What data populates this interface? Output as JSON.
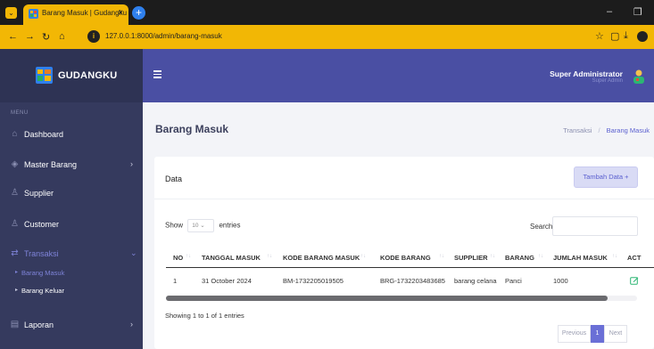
{
  "browser": {
    "tab_title": "Barang Masuk | Gudangku",
    "tab_close": "×",
    "new_tab": "+",
    "url": "127.0.0.1:8000/admin/barang-masuk",
    "minimize": "–",
    "restore": "❐"
  },
  "sidebar": {
    "brand": "GUDANGKU",
    "menu_heading": "MENU",
    "items": [
      {
        "label": "Dashboard",
        "icon": "home-icon"
      },
      {
        "label": "Master Barang",
        "icon": "box-icon",
        "chevron": "›"
      },
      {
        "label": "Supplier",
        "icon": "user-icon"
      },
      {
        "label": "Customer",
        "icon": "user-icon"
      },
      {
        "label": "Transaksi",
        "icon": "swap-icon",
        "chevron": "⌄"
      },
      {
        "label": "Laporan",
        "icon": "file-icon",
        "chevron": "›"
      }
    ],
    "sub_items": [
      {
        "label": "Barang Masuk"
      },
      {
        "label": "Barang Keluar"
      }
    ],
    "sub_arrow": "▸"
  },
  "header": {
    "user_name": "Super Administrator",
    "user_role": "Super Admin"
  },
  "page": {
    "title": "Barang Masuk",
    "breadcrumb": [
      "Transaksi",
      "Barang Masuk"
    ],
    "breadcrumb_sep": "/"
  },
  "card": {
    "title": "Data",
    "add_button": "Tambah Data +",
    "show_label": "Show",
    "entries_value": "10",
    "entries_label": "entries",
    "search_label": "Search:",
    "columns": [
      "NO",
      "TANGGAL MASUK",
      "KODE BARANG MASUK",
      "KODE BARANG",
      "SUPPLIER",
      "BARANG",
      "JUMLAH MASUK",
      "ACT"
    ],
    "sort_glyph": "↑↓",
    "rows": [
      [
        "1",
        "31 October 2024",
        "BM-1732205019505",
        "BRG-1732203483685",
        "barang celana",
        "Panci",
        "1000"
      ]
    ],
    "info": "Showing 1 to 1 of 1 entries",
    "pager": {
      "previous": "Previous",
      "current": "1",
      "next": "Next"
    }
  },
  "colors": {
    "sidebar_bg": "#353a5e",
    "header_bg": "#4a4fa3",
    "accent": "#6a6fd6",
    "browser_accent": "#f2b705",
    "edit_icon": "#2bb673"
  }
}
